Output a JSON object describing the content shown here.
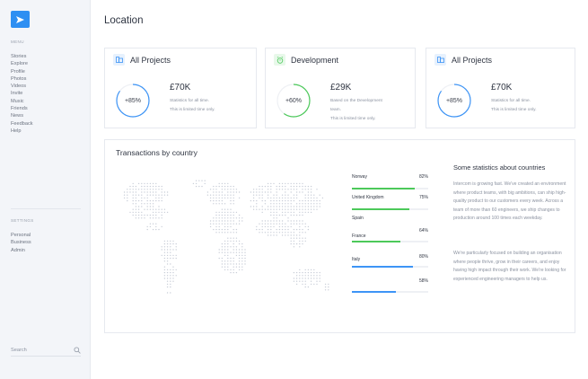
{
  "sidebar": {
    "menu_title": "MENU",
    "items": [
      {
        "label": "Stories"
      },
      {
        "label": "Explore"
      },
      {
        "label": "Profile"
      },
      {
        "label": "Photos"
      },
      {
        "label": "Videos"
      },
      {
        "label": "Invite"
      },
      {
        "label": "Music"
      },
      {
        "label": "Friends"
      },
      {
        "label": "News"
      },
      {
        "label": "Feedback"
      },
      {
        "label": "Help"
      }
    ],
    "settings_title": "SETTINGS",
    "settings_items": [
      {
        "label": "Personal"
      },
      {
        "label": "Business"
      },
      {
        "label": "Admin"
      }
    ],
    "search_placeholder": "Search",
    "logo_icon": "paper-plane-icon",
    "search_icon": "search-icon"
  },
  "page_title": "Location",
  "cards": [
    {
      "title": "All Projects",
      "icon": "folder-icon",
      "percent_label": "+85%",
      "percent": 85,
      "accent": "#3d94f6",
      "value": "£70K",
      "lines": [
        "Statistics for all time.",
        "This is limited time only."
      ]
    },
    {
      "title": "Development",
      "icon": "alarm-clock-icon",
      "percent_label": "+60%",
      "percent": 60,
      "accent": "#4cc95a",
      "value": "£29K",
      "lines": [
        "Based on the Development",
        "team.",
        "This is limited time only."
      ]
    },
    {
      "title": "All Projects",
      "icon": "folder-icon",
      "percent_label": "+85%",
      "percent": 85,
      "accent": "#3d94f6",
      "value": "£70K",
      "lines": [
        "Statistics for all time.",
        "This is limited time only."
      ]
    }
  ],
  "transactions": {
    "title": "Transactions by country",
    "countries": [
      {
        "name": "Norway",
        "value_label": "82%",
        "value": 82,
        "color": "#4cc95a"
      },
      {
        "name": "United Kingdom",
        "value_label": "75%",
        "value": 75,
        "color": "#4cc95a"
      },
      {
        "name": "Spain",
        "value_label": "64%",
        "value": 64,
        "color": "#4cc95a"
      },
      {
        "name": "France",
        "value_label": "",
        "value": 0,
        "color": "#4cc95a"
      },
      {
        "name": "Italy",
        "value_label": "80%",
        "value": 80,
        "color": "#3d94f6"
      },
      {
        "name": "",
        "value_label": "58%",
        "value": 58,
        "color": "#3d94f6"
      }
    ]
  },
  "stats": {
    "title": "Some statistics about countries",
    "paragraph1": "Intercom is growing fast. We've created an environment where product teams, with big ambitions, can ship high-quality product to our customers every week. Across a team of more than 60 engineers, we ship changes to production around 100 times each weekday.",
    "paragraph2": "We're particularly focused on building an organisation where people thrive, grow in their careers, and enjoy having high impact through their work. We're looking for experienced engineering managers to help us."
  },
  "colors": {
    "accent_blue": "#3d94f6",
    "accent_green": "#4cc95a",
    "logo_blue": "#2e8ff2"
  }
}
